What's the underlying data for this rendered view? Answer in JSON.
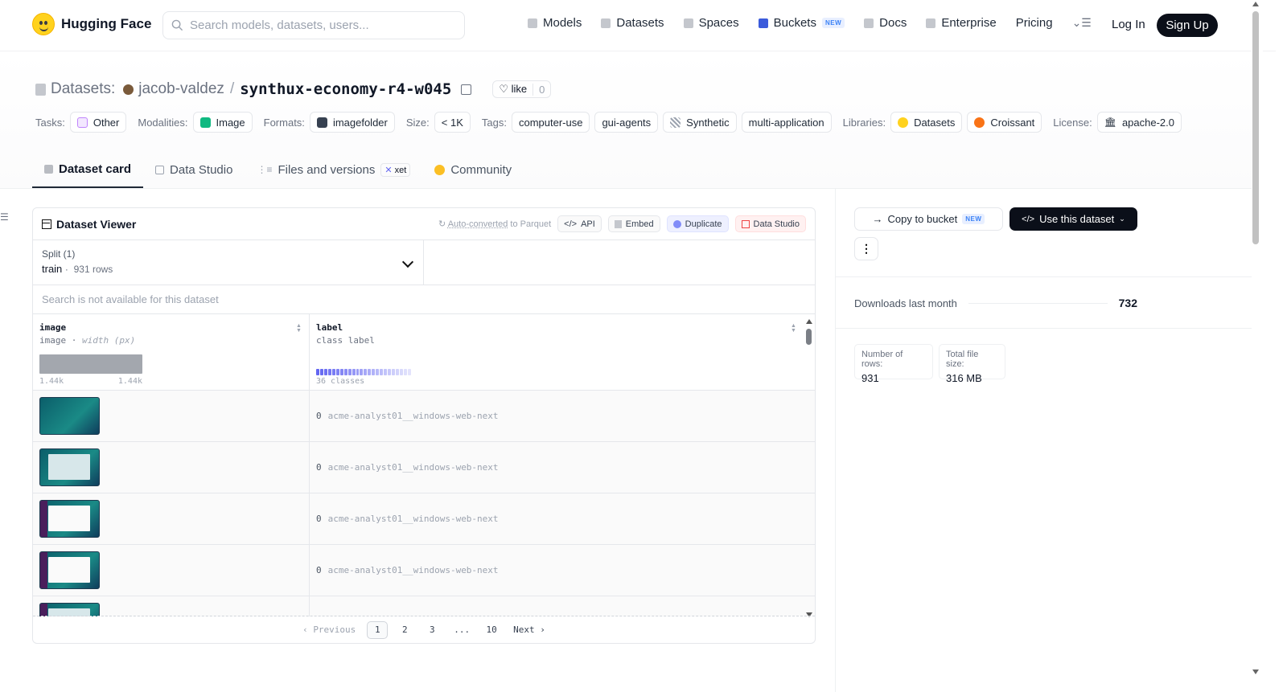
{
  "header": {
    "brand": "Hugging Face",
    "search_placeholder": "Search models, datasets, users...",
    "nav": [
      {
        "label": "Models",
        "icon": "cube-icon"
      },
      {
        "label": "Datasets",
        "icon": "database-icon"
      },
      {
        "label": "Spaces",
        "icon": "grid-icon"
      },
      {
        "label": "Buckets",
        "icon": "bucket-icon",
        "badge": "NEW"
      },
      {
        "label": "Docs",
        "icon": "book-icon"
      },
      {
        "label": "Enterprise",
        "icon": "enterprise-icon"
      },
      {
        "label": "Pricing"
      }
    ],
    "login": "Log In",
    "signup": "Sign Up"
  },
  "dataset": {
    "section": "Datasets:",
    "owner": "jacob-valdez",
    "name": "synthux-economy-r4-w045",
    "like_label": "like",
    "like_count": "0"
  },
  "meta": {
    "tasks_label": "Tasks:",
    "tasks": "Other",
    "modalities_label": "Modalities:",
    "modality": "Image",
    "formats_label": "Formats:",
    "format": "imagefolder",
    "size_label": "Size:",
    "size": "< 1K",
    "tags_label": "Tags:",
    "tags": [
      "computer-use",
      "gui-agents",
      "Synthetic",
      "multi-application"
    ],
    "libraries_label": "Libraries:",
    "libraries": [
      "Datasets",
      "Croissant"
    ],
    "license_label": "License:",
    "license": "apache-2.0"
  },
  "tabs": [
    "Dataset card",
    "Data Studio",
    "Files and versions",
    "Community"
  ],
  "tab_badge": "xet",
  "viewer": {
    "title": "Dataset Viewer",
    "auto_converted": "Auto-converted",
    "to_parquet": " to Parquet",
    "actions": [
      "API",
      "Embed",
      "Duplicate",
      "Data Studio"
    ],
    "split_label": "Split (1)",
    "split_name": "train",
    "split_rows": "931 rows",
    "search_na": "Search is not available for this dataset",
    "col1": {
      "name": "image",
      "type": "image",
      "sub": "width (px)",
      "min": "1.44k",
      "max": "1.44k"
    },
    "col2": {
      "name": "label",
      "type": "class label",
      "classes": "36 classes"
    },
    "rows": [
      {
        "idx": "0",
        "label": "acme-analyst01__windows-web-next"
      },
      {
        "idx": "0",
        "label": "acme-analyst01__windows-web-next"
      },
      {
        "idx": "0",
        "label": "acme-analyst01__windows-web-next"
      },
      {
        "idx": "0",
        "label": "acme-analyst01__windows-web-next"
      }
    ],
    "pager": {
      "prev": "Previous",
      "pages": [
        "1",
        "2",
        "3",
        "...",
        "10"
      ],
      "next": "Next"
    }
  },
  "sidebar": {
    "copy_bucket": "Copy to bucket",
    "copy_badge": "NEW",
    "use_dataset": "Use this dataset",
    "downloads_label": "Downloads last month",
    "downloads_value": "732",
    "rows_label": "Number of rows:",
    "rows_value": "931",
    "size_label": "Total file size:",
    "size_value": "316 MB"
  },
  "colors": {
    "accent": "#0b0f19",
    "class_bar": "#6366f1",
    "brand": "#ffd21e"
  }
}
